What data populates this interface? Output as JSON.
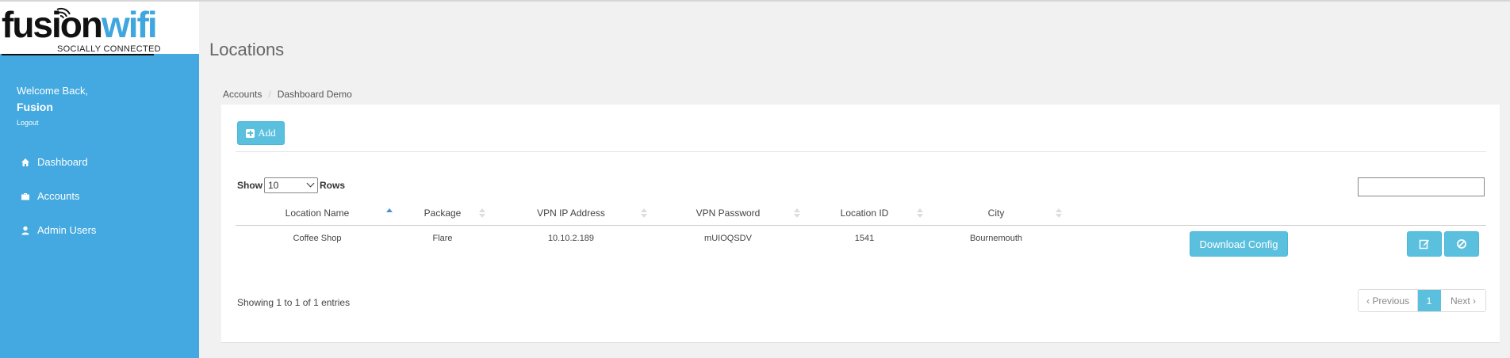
{
  "brand": {
    "name_part1": "fusion",
    "name_part2": "wifi",
    "tagline": "SOCIALLY CONNECTED",
    "accent_color": "#43a9e0"
  },
  "sidebar": {
    "welcome": "Welcome Back,",
    "username": "Fusion",
    "logout": "Logout",
    "items": [
      {
        "label": "Dashboard",
        "icon": "home-icon"
      },
      {
        "label": "Accounts",
        "icon": "briefcase-icon"
      },
      {
        "label": "Admin Users",
        "icon": "user-icon"
      }
    ]
  },
  "page": {
    "title": "Locations",
    "breadcrumb": [
      "Accounts",
      "Dashboard Demo"
    ]
  },
  "toolbar": {
    "add_label": "Add"
  },
  "table_controls": {
    "show_label": "Show",
    "rows_value": "10",
    "rows_label": "Rows",
    "search_value": ""
  },
  "table": {
    "columns": [
      "Location Name",
      "Package",
      "VPN IP Address",
      "VPN Password",
      "Location ID",
      "City"
    ],
    "rows": [
      {
        "location_name": "Coffee Shop",
        "package": "Flare",
        "vpn_ip": "10.10.2.189",
        "vpn_password": "mUIOQSDV",
        "location_id": "1541",
        "city": "Bournemouth",
        "download_label": "Download Config"
      }
    ]
  },
  "footer": {
    "showing": "Showing 1 to 1 of 1 entries",
    "prev": "Previous",
    "page": "1",
    "next": "Next"
  }
}
